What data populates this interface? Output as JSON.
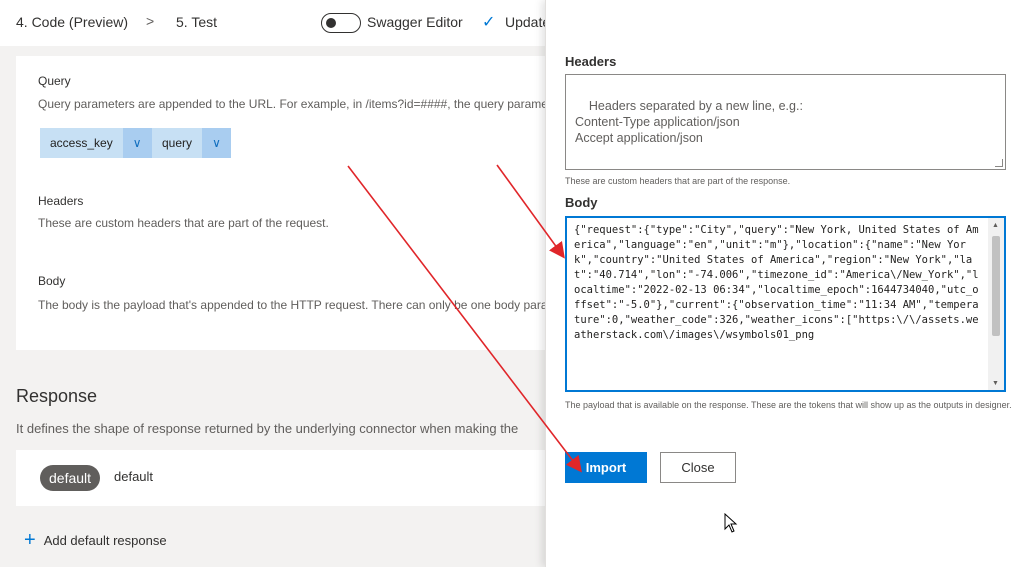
{
  "nav": {
    "step4": "4. Code (Preview)",
    "separator": ">",
    "step5": "5. Test",
    "swagger_label": "Swagger Editor",
    "update_label": "Update"
  },
  "request": {
    "query_title": "Query",
    "query_desc": "Query parameters are appended to the URL. For example, in /items?id=####, the query parameter is",
    "params": [
      {
        "label": "access_key",
        "dropdown": "∨"
      },
      {
        "label": "query",
        "dropdown": "∨"
      }
    ],
    "headers_title": "Headers",
    "headers_desc": "These are custom headers that are part of the request.",
    "body_title": "Body",
    "body_desc": "The body is the payload that's appended to the HTTP request. There can only be one body parameter"
  },
  "response": {
    "title": "Response",
    "desc": "It defines the shape of response returned by the underlying connector when making the",
    "badge": "default",
    "default_text": "default",
    "add_label": "Add default response",
    "add_icon": "+"
  },
  "panel": {
    "headers_label": "Headers",
    "headers_placeholder": "Headers separated by a new line, e.g.:\nContent-Type application/json\nAccept application/json",
    "headers_help": "These are custom headers that are part of the response.",
    "body_label": "Body",
    "body_value": "{\"request\":{\"type\":\"City\",\"query\":\"New York, United States of America\",\"language\":\"en\",\"unit\":\"m\"},\"location\":{\"name\":\"New York\",\"country\":\"United States of America\",\"region\":\"New York\",\"lat\":\"40.714\",\"lon\":\"-74.006\",\"timezone_id\":\"America\\/New_York\",\"localtime\":\"2022-02-13 06:34\",\"localtime_epoch\":1644734040,\"utc_offset\":\"-5.0\"},\"current\":{\"observation_time\":\"11:34 AM\",\"temperature\":0,\"weather_code\":326,\"weather_icons\":[\"https:\\/\\/assets.weatherstack.com\\/images\\/wsymbols01_png",
    "body_help": "The payload that is available on the response. These are the tokens that will show up as the outputs in designer.",
    "import_label": "Import",
    "close_label": "Close"
  },
  "colors": {
    "accent": "#0078d4",
    "arrow": "#e0262a",
    "pill": "#c7e0f4"
  }
}
